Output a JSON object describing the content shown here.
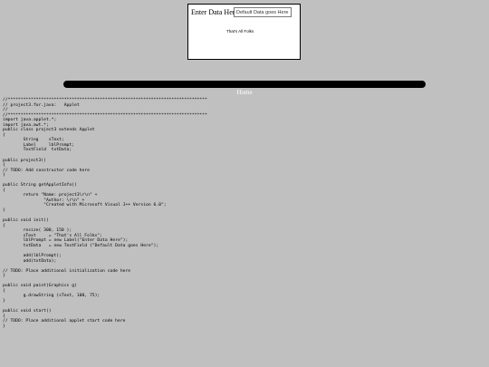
{
  "applet": {
    "label": "Enter Data Here",
    "textfield_value": "Default Data goes Here",
    "drawn_text": "That's All Folks"
  },
  "nav": {
    "home_label": "Home"
  },
  "source": {
    "code": "//******************************************************************************\n// project3.for.java:   Applet\n//\n//******************************************************************************\nimport java.applet.*;\nimport java.awt.*;\npublic class project3 extends Applet\n{\n        String    sText;\n        Label     lblPrompt;\n        TextField  txtData;\n\npublic project3()\n{\n// TODO: Add constructor code here\n}\n\npublic String getAppletInfo()\n{\n        return \"Name: project3\\r\\n\" +\n                \"Author: \\r\\n\" +\n                \"Created with Microsoft Visual J++ Version 6.0\";\n}\n\npublic void init()\n{\n        resize( 300, 150 );\n        sText     = \"That's All Folks\";\n        lblPrompt = new Label(\"Enter Data Here\");\n        txtData   = new TextField (\"Default Data goes Here\");\n\n        add(lblPrompt);\n        add(txtData);\n\n// TODO: Place additional initialization code here\n}\n\npublic void paint(Graphics g)\n{\n        g.drawString (sText, 100, 75);\n}\n\npublic void start()\n{\n// TODO: Place additional applet start code here\n}"
  }
}
